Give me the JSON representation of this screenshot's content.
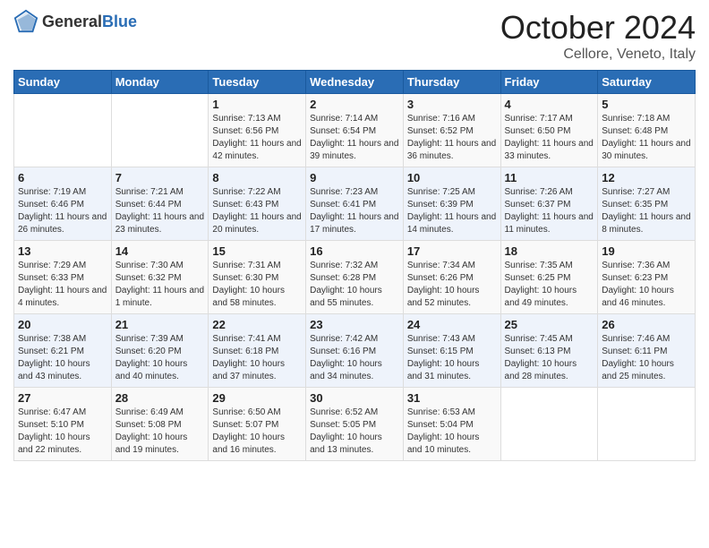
{
  "header": {
    "logo_general": "General",
    "logo_blue": "Blue",
    "month": "October 2024",
    "location": "Cellore, Veneto, Italy"
  },
  "days_of_week": [
    "Sunday",
    "Monday",
    "Tuesday",
    "Wednesday",
    "Thursday",
    "Friday",
    "Saturday"
  ],
  "weeks": [
    [
      {
        "day": "",
        "sunrise": "",
        "sunset": "",
        "daylight": ""
      },
      {
        "day": "",
        "sunrise": "",
        "sunset": "",
        "daylight": ""
      },
      {
        "day": "1",
        "sunrise": "Sunrise: 7:13 AM",
        "sunset": "Sunset: 6:56 PM",
        "daylight": "Daylight: 11 hours and 42 minutes."
      },
      {
        "day": "2",
        "sunrise": "Sunrise: 7:14 AM",
        "sunset": "Sunset: 6:54 PM",
        "daylight": "Daylight: 11 hours and 39 minutes."
      },
      {
        "day": "3",
        "sunrise": "Sunrise: 7:16 AM",
        "sunset": "Sunset: 6:52 PM",
        "daylight": "Daylight: 11 hours and 36 minutes."
      },
      {
        "day": "4",
        "sunrise": "Sunrise: 7:17 AM",
        "sunset": "Sunset: 6:50 PM",
        "daylight": "Daylight: 11 hours and 33 minutes."
      },
      {
        "day": "5",
        "sunrise": "Sunrise: 7:18 AM",
        "sunset": "Sunset: 6:48 PM",
        "daylight": "Daylight: 11 hours and 30 minutes."
      }
    ],
    [
      {
        "day": "6",
        "sunrise": "Sunrise: 7:19 AM",
        "sunset": "Sunset: 6:46 PM",
        "daylight": "Daylight: 11 hours and 26 minutes."
      },
      {
        "day": "7",
        "sunrise": "Sunrise: 7:21 AM",
        "sunset": "Sunset: 6:44 PM",
        "daylight": "Daylight: 11 hours and 23 minutes."
      },
      {
        "day": "8",
        "sunrise": "Sunrise: 7:22 AM",
        "sunset": "Sunset: 6:43 PM",
        "daylight": "Daylight: 11 hours and 20 minutes."
      },
      {
        "day": "9",
        "sunrise": "Sunrise: 7:23 AM",
        "sunset": "Sunset: 6:41 PM",
        "daylight": "Daylight: 11 hours and 17 minutes."
      },
      {
        "day": "10",
        "sunrise": "Sunrise: 7:25 AM",
        "sunset": "Sunset: 6:39 PM",
        "daylight": "Daylight: 11 hours and 14 minutes."
      },
      {
        "day": "11",
        "sunrise": "Sunrise: 7:26 AM",
        "sunset": "Sunset: 6:37 PM",
        "daylight": "Daylight: 11 hours and 11 minutes."
      },
      {
        "day": "12",
        "sunrise": "Sunrise: 7:27 AM",
        "sunset": "Sunset: 6:35 PM",
        "daylight": "Daylight: 11 hours and 8 minutes."
      }
    ],
    [
      {
        "day": "13",
        "sunrise": "Sunrise: 7:29 AM",
        "sunset": "Sunset: 6:33 PM",
        "daylight": "Daylight: 11 hours and 4 minutes."
      },
      {
        "day": "14",
        "sunrise": "Sunrise: 7:30 AM",
        "sunset": "Sunset: 6:32 PM",
        "daylight": "Daylight: 11 hours and 1 minute."
      },
      {
        "day": "15",
        "sunrise": "Sunrise: 7:31 AM",
        "sunset": "Sunset: 6:30 PM",
        "daylight": "Daylight: 10 hours and 58 minutes."
      },
      {
        "day": "16",
        "sunrise": "Sunrise: 7:32 AM",
        "sunset": "Sunset: 6:28 PM",
        "daylight": "Daylight: 10 hours and 55 minutes."
      },
      {
        "day": "17",
        "sunrise": "Sunrise: 7:34 AM",
        "sunset": "Sunset: 6:26 PM",
        "daylight": "Daylight: 10 hours and 52 minutes."
      },
      {
        "day": "18",
        "sunrise": "Sunrise: 7:35 AM",
        "sunset": "Sunset: 6:25 PM",
        "daylight": "Daylight: 10 hours and 49 minutes."
      },
      {
        "day": "19",
        "sunrise": "Sunrise: 7:36 AM",
        "sunset": "Sunset: 6:23 PM",
        "daylight": "Daylight: 10 hours and 46 minutes."
      }
    ],
    [
      {
        "day": "20",
        "sunrise": "Sunrise: 7:38 AM",
        "sunset": "Sunset: 6:21 PM",
        "daylight": "Daylight: 10 hours and 43 minutes."
      },
      {
        "day": "21",
        "sunrise": "Sunrise: 7:39 AM",
        "sunset": "Sunset: 6:20 PM",
        "daylight": "Daylight: 10 hours and 40 minutes."
      },
      {
        "day": "22",
        "sunrise": "Sunrise: 7:41 AM",
        "sunset": "Sunset: 6:18 PM",
        "daylight": "Daylight: 10 hours and 37 minutes."
      },
      {
        "day": "23",
        "sunrise": "Sunrise: 7:42 AM",
        "sunset": "Sunset: 6:16 PM",
        "daylight": "Daylight: 10 hours and 34 minutes."
      },
      {
        "day": "24",
        "sunrise": "Sunrise: 7:43 AM",
        "sunset": "Sunset: 6:15 PM",
        "daylight": "Daylight: 10 hours and 31 minutes."
      },
      {
        "day": "25",
        "sunrise": "Sunrise: 7:45 AM",
        "sunset": "Sunset: 6:13 PM",
        "daylight": "Daylight: 10 hours and 28 minutes."
      },
      {
        "day": "26",
        "sunrise": "Sunrise: 7:46 AM",
        "sunset": "Sunset: 6:11 PM",
        "daylight": "Daylight: 10 hours and 25 minutes."
      }
    ],
    [
      {
        "day": "27",
        "sunrise": "Sunrise: 6:47 AM",
        "sunset": "Sunset: 5:10 PM",
        "daylight": "Daylight: 10 hours and 22 minutes."
      },
      {
        "day": "28",
        "sunrise": "Sunrise: 6:49 AM",
        "sunset": "Sunset: 5:08 PM",
        "daylight": "Daylight: 10 hours and 19 minutes."
      },
      {
        "day": "29",
        "sunrise": "Sunrise: 6:50 AM",
        "sunset": "Sunset: 5:07 PM",
        "daylight": "Daylight: 10 hours and 16 minutes."
      },
      {
        "day": "30",
        "sunrise": "Sunrise: 6:52 AM",
        "sunset": "Sunset: 5:05 PM",
        "daylight": "Daylight: 10 hours and 13 minutes."
      },
      {
        "day": "31",
        "sunrise": "Sunrise: 6:53 AM",
        "sunset": "Sunset: 5:04 PM",
        "daylight": "Daylight: 10 hours and 10 minutes."
      },
      {
        "day": "",
        "sunrise": "",
        "sunset": "",
        "daylight": ""
      },
      {
        "day": "",
        "sunrise": "",
        "sunset": "",
        "daylight": ""
      }
    ]
  ]
}
